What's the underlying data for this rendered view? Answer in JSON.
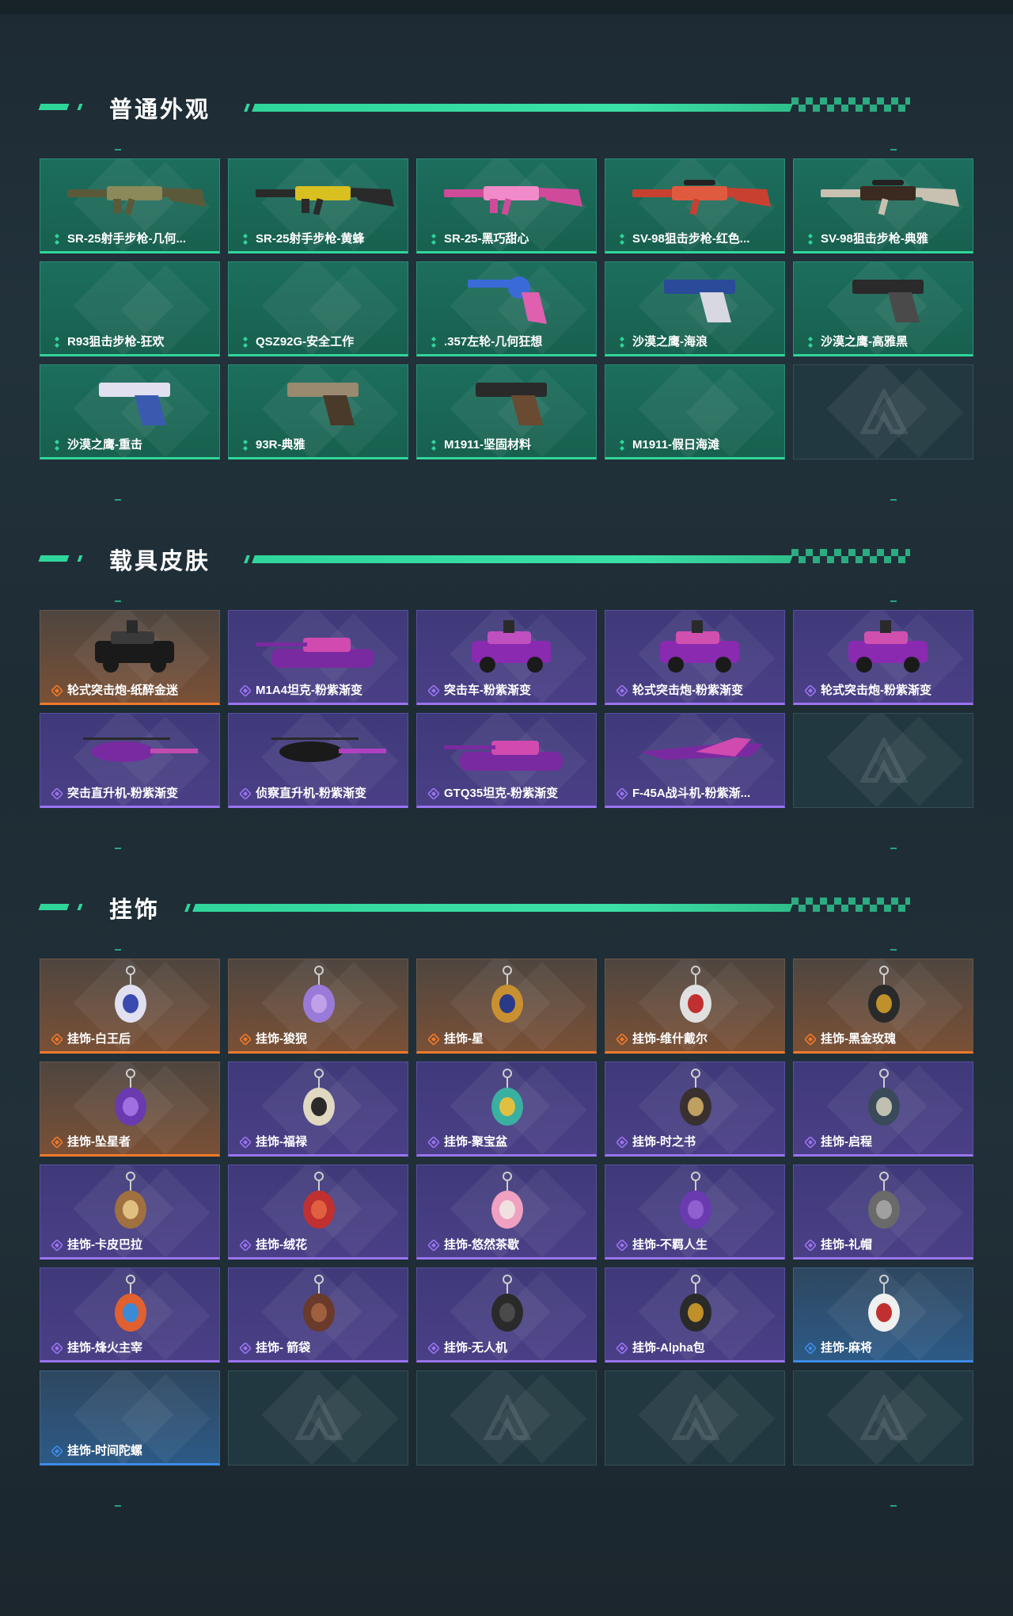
{
  "sections": [
    {
      "title": "普通外观",
      "items": [
        {
          "label": "SR-25射手步枪-几何...",
          "rarity": "teal",
          "art": "rifle",
          "colors": [
            "#5a5a3a",
            "#8a8a5a"
          ]
        },
        {
          "label": "SR-25射手步枪-黄蜂",
          "rarity": "teal",
          "art": "rifle",
          "colors": [
            "#2a2a2a",
            "#d8c020"
          ]
        },
        {
          "label": "SR-25-黑巧甜心",
          "rarity": "teal",
          "art": "rifle",
          "colors": [
            "#d04a9a",
            "#f08ac8"
          ]
        },
        {
          "label": "SV-98狙击步枪-红色...",
          "rarity": "teal",
          "art": "sniper",
          "colors": [
            "#c84030",
            "#e05a40"
          ]
        },
        {
          "label": "SV-98狙击步枪-典雅",
          "rarity": "teal",
          "art": "sniper",
          "colors": [
            "#c8c0b0",
            "#3a2a20"
          ]
        },
        {
          "label": "R93狙击步枪-狂欢",
          "rarity": "teal",
          "art": "none"
        },
        {
          "label": "QSZ92G-安全工作",
          "rarity": "teal",
          "art": "none"
        },
        {
          "label": ".357左轮-几何狂想",
          "rarity": "teal",
          "art": "revolver",
          "colors": [
            "#3a6ad8",
            "#e060b0"
          ]
        },
        {
          "label": "沙漠之鹰-海浪",
          "rarity": "teal",
          "art": "pistol",
          "colors": [
            "#2a4a9a",
            "#d8d8e0"
          ]
        },
        {
          "label": "沙漠之鹰-高雅黑",
          "rarity": "teal",
          "art": "pistol",
          "colors": [
            "#2a2a2a",
            "#4a4a4a"
          ]
        },
        {
          "label": "沙漠之鹰-重击",
          "rarity": "teal",
          "art": "pistol",
          "colors": [
            "#e0e0f0",
            "#3a5ab0"
          ]
        },
        {
          "label": "93R-典雅",
          "rarity": "teal",
          "art": "pistol",
          "colors": [
            "#9a8a70",
            "#4a3a2a"
          ]
        },
        {
          "label": "M1911-坚固材料",
          "rarity": "teal",
          "art": "pistol",
          "colors": [
            "#2a2a2a",
            "#6a4a30"
          ]
        },
        {
          "label": "M1911-假日海滩",
          "rarity": "teal",
          "art": "none"
        },
        {
          "label": "",
          "rarity": "empty",
          "art": "none"
        }
      ]
    },
    {
      "title": "载具皮肤",
      "items": [
        {
          "label": "轮式突击炮-纸醉金迷",
          "rarity": "orange",
          "art": "car",
          "colors": [
            "#1a1a1a",
            "#3a3a3a"
          ]
        },
        {
          "label": "M1A4坦克-粉紫渐变",
          "rarity": "purple",
          "art": "tank",
          "colors": [
            "#7a2aa0",
            "#d04ab0"
          ]
        },
        {
          "label": "突击车-粉紫渐变",
          "rarity": "purple",
          "art": "car",
          "colors": [
            "#8a2ab0",
            "#c050c0"
          ]
        },
        {
          "label": "轮式突击炮-粉紫渐变",
          "rarity": "purple",
          "art": "car",
          "colors": [
            "#8a2ab0",
            "#d050b0"
          ]
        },
        {
          "label": "轮式突击炮-粉紫渐变",
          "rarity": "purple",
          "art": "car",
          "colors": [
            "#8a2ab0",
            "#d050b0"
          ]
        },
        {
          "label": "突击直升机-粉紫渐变",
          "rarity": "purple",
          "art": "heli",
          "colors": [
            "#7a2aa0",
            "#c04ab0"
          ]
        },
        {
          "label": "侦察直升机-粉紫渐变",
          "rarity": "purple",
          "art": "heli",
          "colors": [
            "#1a1a1a",
            "#b040c0"
          ]
        },
        {
          "label": "GTQ35坦克-粉紫渐变",
          "rarity": "purple",
          "art": "tank",
          "colors": [
            "#7a2aa0",
            "#d04ab0"
          ]
        },
        {
          "label": "F-45A战斗机-粉紫渐...",
          "rarity": "purple",
          "art": "jet",
          "colors": [
            "#7a2aa0",
            "#d04ab0"
          ]
        },
        {
          "label": "",
          "rarity": "empty",
          "art": "none"
        }
      ]
    },
    {
      "title": "挂饰",
      "items": [
        {
          "label": "挂饰-白王后",
          "rarity": "orange",
          "art": "charm",
          "colors": [
            "#e0e0f0",
            "#3a4ab0"
          ]
        },
        {
          "label": "挂饰-狻猊",
          "rarity": "orange",
          "art": "charm",
          "colors": [
            "#9a7ad8",
            "#c0a0e8"
          ]
        },
        {
          "label": "挂饰-星",
          "rarity": "orange",
          "art": "charm",
          "colors": [
            "#c89030",
            "#2a3a8a"
          ]
        },
        {
          "label": "挂饰-维什戴尔",
          "rarity": "orange",
          "art": "charm",
          "colors": [
            "#e0e0e0",
            "#c03030"
          ]
        },
        {
          "label": "挂饰-黑金玫瑰",
          "rarity": "orange",
          "art": "charm",
          "colors": [
            "#2a2a2a",
            "#c0902a"
          ]
        },
        {
          "label": "挂饰-坠星者",
          "rarity": "orange",
          "art": "charm",
          "colors": [
            "#6a3ab0",
            "#a070e0"
          ]
        },
        {
          "label": "挂饰-福禄",
          "rarity": "purple",
          "art": "charm",
          "colors": [
            "#e0d8c0",
            "#2a2a2a"
          ]
        },
        {
          "label": "挂饰-聚宝盆",
          "rarity": "purple",
          "art": "charm",
          "colors": [
            "#3ab0a0",
            "#e0c040"
          ]
        },
        {
          "label": "挂饰-时之书",
          "rarity": "purple",
          "art": "charm",
          "colors": [
            "#3a3030",
            "#c0a060"
          ]
        },
        {
          "label": "挂饰-启程",
          "rarity": "purple",
          "art": "charm",
          "colors": [
            "#3a4a5a",
            "#c0c0b0"
          ]
        },
        {
          "label": "挂饰-卡皮巴拉",
          "rarity": "purple",
          "art": "charm",
          "colors": [
            "#a07040",
            "#e0c080"
          ]
        },
        {
          "label": "挂饰-绒花",
          "rarity": "purple",
          "art": "charm",
          "colors": [
            "#c03030",
            "#e06040"
          ]
        },
        {
          "label": "挂饰-悠然茶歇",
          "rarity": "purple",
          "art": "charm",
          "colors": [
            "#f0a0c0",
            "#f0e0e0"
          ]
        },
        {
          "label": "挂饰-不羁人生",
          "rarity": "purple",
          "art": "charm",
          "colors": [
            "#6a3ab0",
            "#9060d0"
          ]
        },
        {
          "label": "挂饰-礼帽",
          "rarity": "purple",
          "art": "charm",
          "colors": [
            "#6a6a6a",
            "#a0a0a0"
          ]
        },
        {
          "label": "挂饰-烽火主宰",
          "rarity": "purple",
          "art": "charm",
          "colors": [
            "#e06030",
            "#3a8ad8"
          ]
        },
        {
          "label": "挂饰- 箭袋",
          "rarity": "purple",
          "art": "charm",
          "colors": [
            "#6a3a2a",
            "#a06040"
          ]
        },
        {
          "label": "挂饰-无人机",
          "rarity": "purple",
          "art": "charm",
          "colors": [
            "#2a2a2a",
            "#4a4a4a"
          ]
        },
        {
          "label": "挂饰-Alpha包",
          "rarity": "purple",
          "art": "charm",
          "colors": [
            "#2a2a2a",
            "#c0902a"
          ]
        },
        {
          "label": "挂饰-麻将",
          "rarity": "blue",
          "art": "charm",
          "colors": [
            "#f0f0f0",
            "#c03030"
          ]
        },
        {
          "label": "挂饰-时间陀螺",
          "rarity": "blue",
          "art": "none"
        },
        {
          "label": "",
          "rarity": "empty",
          "art": "none"
        },
        {
          "label": "",
          "rarity": "empty",
          "art": "none"
        },
        {
          "label": "",
          "rarity": "empty",
          "art": "none"
        },
        {
          "label": "",
          "rarity": "empty",
          "art": "none"
        }
      ]
    }
  ],
  "rarity_colors": {
    "teal": "#2fd69a",
    "purple": "#9a74f0",
    "orange": "#f07a2a",
    "blue": "#3d8ce8",
    "accent": "#2fd69a"
  },
  "icons": {
    "rarity": "rarity-diamond-icon",
    "placeholder": "game-logo-icon"
  }
}
